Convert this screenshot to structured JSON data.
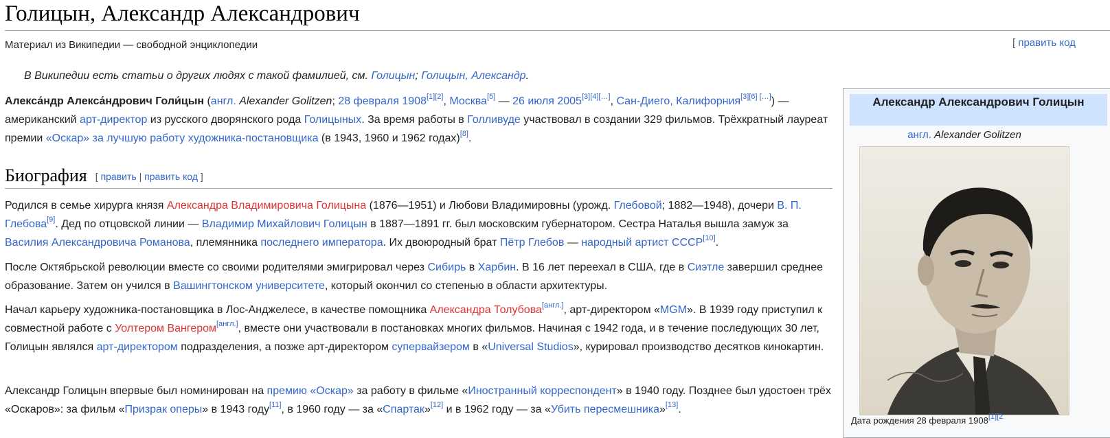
{
  "title": "Голицын, Александр Александрович",
  "tagline": "Материал из Википедии — свободной энциклопедии",
  "edit_top": {
    "open": "[ ",
    "label": "править код"
  },
  "hatnote": {
    "text": "В Википедии есть статьи о других людях с такой фамилией, см. ",
    "link1": "Голицын",
    "sep": "; ",
    "link2": "Голицын, Александр",
    "end": "."
  },
  "lead": {
    "name": "Алекса́ндр Алекса́ндрович Голи́цын",
    "t1": " (",
    "lang": "англ.",
    "orig": " Alexander Golitzen",
    "t2": "; ",
    "birth": "28 февраля 1908",
    "ref1": "[1]",
    "ref2": "[2]",
    "t3": ", ",
    "birthplace": "Москва",
    "ref5": "[5]",
    "t4": " — ",
    "death": "26 июля 2005",
    "ref3": "[3]",
    "ref4": "[4]",
    "refx": "[…]",
    "t5": ", ",
    "deathplace": "Сан-Диего, Калифорния",
    "ref3b": "[3]",
    "ref6": "[6]",
    "refx2": "[…]",
    "t6": ") — американский ",
    "artdir": "арт-директор",
    "t7": " из русского дворянского рода ",
    "family": "Голицыных",
    "t8": ". За время работы в ",
    "hollywood": "Голливуде",
    "t9": " участвовал в создании 329 фильмов. Трёхкратный лауреат премии ",
    "oscar": "«Оскар» за лучшую работу художника-постановщика",
    "t10": " (в 1943, 1960 и 1962 годах)",
    "ref8": "[8]",
    "t11": "."
  },
  "section": {
    "heading": "Биография",
    "open": "[ ",
    "edit": "править",
    "sep": " | ",
    "edit_code": "править код",
    "close": " ]"
  },
  "p1": {
    "a": "Родился в семье хирурга князя ",
    "father": "Александра Владимировича Голицына",
    "b": " (1876—1951) и Любови Владимировны (урожд. ",
    "glebova": "Глебовой",
    "c": "; 1882—1948), дочери ",
    "glebov": "В. П. Глебова",
    "ref9": "[9]",
    "d": ". Дед по отцовской линии — ",
    "grandfather": "Владимир Михайлович Голицын",
    "e": " в 1887—1891 гг. был московским губернатором. Сестра Наталья вышла замуж за ",
    "romanov": "Василия Александровича Романова",
    "f": ", племянника ",
    "emperor": "последнего императора",
    "g": ". Их двоюродный брат ",
    "petr": "Пётр Глебов",
    "h": " — ",
    "artist": "народный артист СССР",
    "ref10": "[10]",
    "i": "."
  },
  "p2": {
    "a": "После Октябрьской революции вместе со своими родителями эмигрировал через ",
    "siberia": "Сибирь",
    "b": " в ",
    "harbin": "Харбин",
    "c": ". В 16 лет переехал в США, где в ",
    "seattle": "Сиэтле",
    "d": " завершил среднее образование. Затем он учился в ",
    "uw": "Вашингтонском университете",
    "e": ", который окончил со степенью в области архитектуры."
  },
  "p3": {
    "a": "Начал карьеру художника-постановщика в Лос-Анджелесе, в качестве помощника ",
    "tolubov": "Александра Толубова",
    "eng1": "[англ.]",
    "b": ", арт-директором «",
    "mgm": "MGM",
    "c": "». В 1939 году приступил к совместной работе с ",
    "wanger": "Уолтером Вангером",
    "eng2": "[англ.]",
    "d": ", вместе они участвовали в постановках многих фильмов. Начиная с 1942 года, и в течение последующих 30 лет, Голицын являлся ",
    "artdir": "арт-директором",
    "e": " подразделения, а позже арт-директором ",
    "supervisor": "супервайзером",
    "f": " в «",
    "universal": "Universal Studios",
    "g": "», курировал производство десятков кинокартин."
  },
  "p4": {
    "a": "Александр Голицын впервые был номинирован на ",
    "oscar": "премию «Оскар»",
    "b": " за работу в фильме «",
    "film1": "Иностранный корреспондент",
    "c": "» в 1940 году. Позднее был удостоен трёх «Оскаров»: за фильм «",
    "film2": "Призрак оперы",
    "d": "» в 1943 году",
    "ref11": "[11]",
    "e": ", в 1960 году — за «",
    "film3": "Спартак",
    "f": "»",
    "ref12": "[12]",
    "g": " и в 1962 году — за «",
    "film4": "Убить пересмешника",
    "h": "»",
    "ref13": "[13]",
    "i": "."
  },
  "infobox": {
    "title": "Александр Александрович Голицын",
    "orig_lang": "англ.",
    "orig_name": " Alexander Golitzen",
    "caption": "Дата рождения   28 февраля 1908",
    "caption_refs": "[1][2"
  },
  "colors": {
    "link": "#3366cc",
    "redlink": "#d33",
    "infobox_header": "#cfe3ff"
  }
}
